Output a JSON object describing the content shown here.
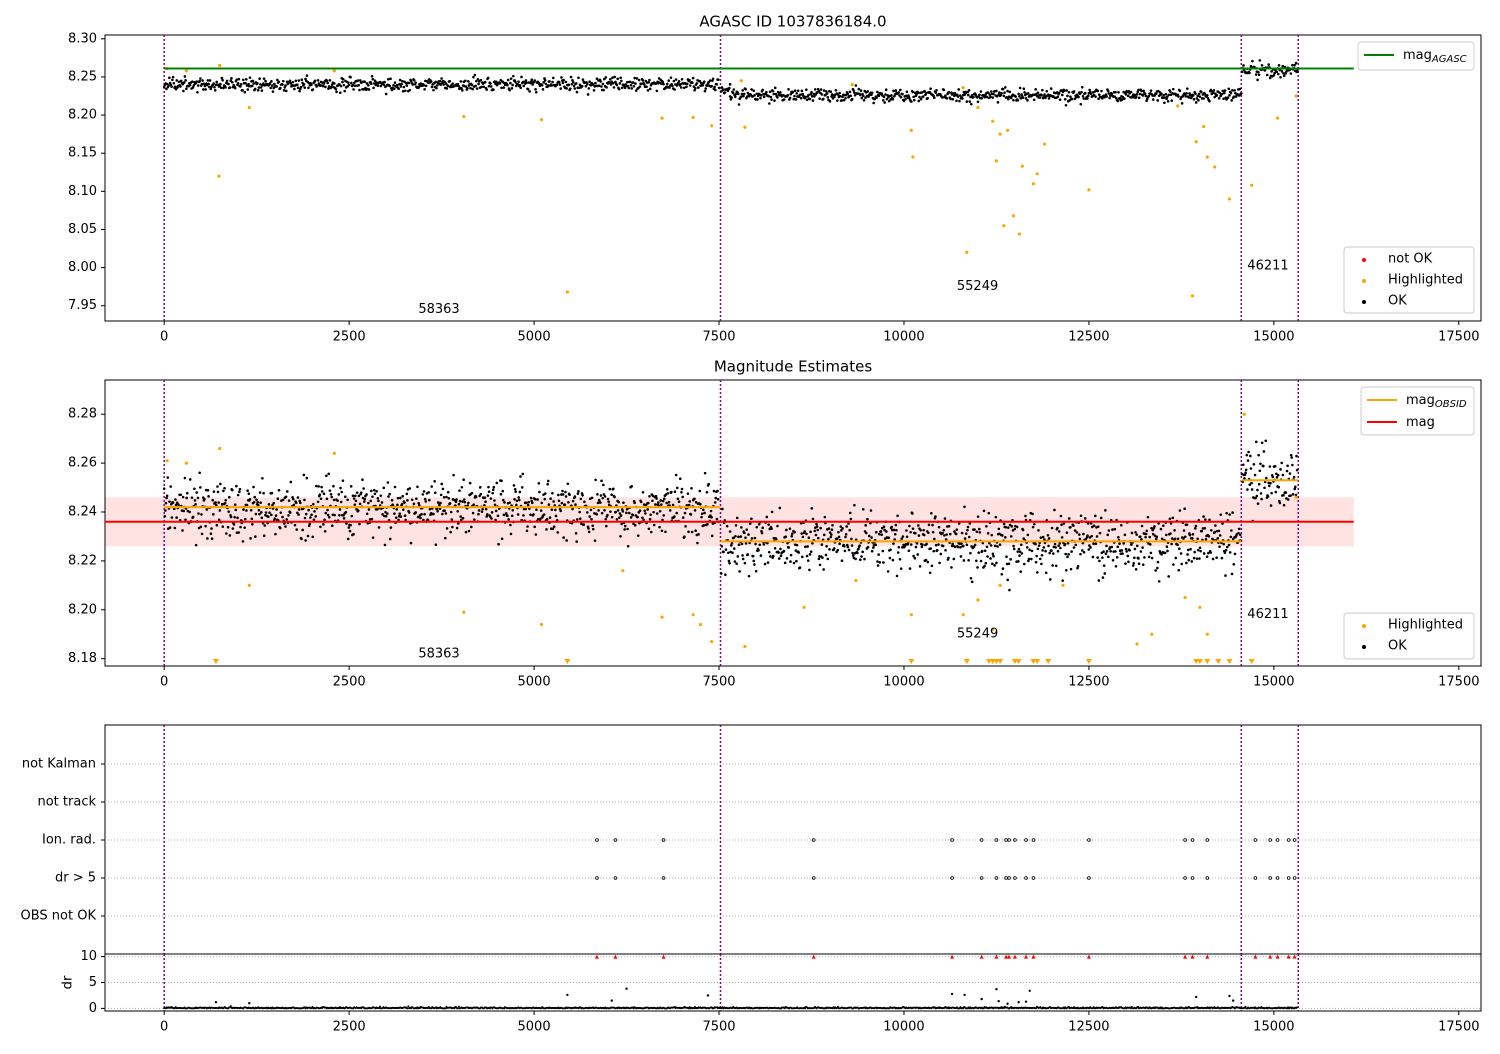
{
  "figure": {
    "x_ticks": [
      0,
      2500,
      5000,
      7500,
      10000,
      12500,
      15000,
      17500
    ],
    "obsids": [
      {
        "id": "58363",
        "start": 0,
        "end": 7520
      },
      {
        "id": "55249",
        "start": 7520,
        "end": 14560
      },
      {
        "id": "46211",
        "start": 14560,
        "end": 15330
      }
    ],
    "colors": {
      "ok": "#000000",
      "highlighted": "#ffa500",
      "not_ok": "#ff0000",
      "agasc": "#008000",
      "obsid_mag": "#ffa500",
      "mag": "#ff0000",
      "band": "#ffe0e0",
      "boundary": "#800080"
    }
  },
  "chart_data": [
    {
      "type": "scatter",
      "title": "AGASC ID 1037836184.0",
      "xlim": [
        -800,
        17800
      ],
      "ylim": [
        7.93,
        8.305
      ],
      "y_ticks": [
        7.95,
        8.0,
        8.05,
        8.1,
        8.15,
        8.2,
        8.25,
        8.3
      ],
      "y_tick_labels": [
        "7.95",
        "8.00",
        "8.05",
        "8.10",
        "8.15",
        "8.20",
        "8.25",
        "8.30"
      ],
      "lines": [
        {
          "name": "AGASC",
          "y": 8.261,
          "x": [
            0,
            16080
          ]
        }
      ],
      "legend": {
        "top_right": [
          {
            "prefix": "mag",
            "sub": "AGASC",
            "kind": "line",
            "color": "#008000"
          }
        ],
        "bottom_right": [
          {
            "label": "not OK",
            "kind": "dot",
            "color": "#ff0000"
          },
          {
            "label": "Highlighted",
            "kind": "dot",
            "color": "#ffa500"
          },
          {
            "label": "OK",
            "kind": "dot",
            "color": "#000000"
          }
        ]
      },
      "obsid_label_y": [
        7.945,
        7.975,
        8.002
      ],
      "highlighted": [
        [
          40,
          8.261
        ],
        [
          300,
          8.258
        ],
        [
          750,
          8.265
        ],
        [
          740,
          8.12
        ],
        [
          1150,
          8.21
        ],
        [
          2300,
          8.258
        ],
        [
          4050,
          8.198
        ],
        [
          5100,
          8.194
        ],
        [
          5450,
          7.968
        ],
        [
          6730,
          8.196
        ],
        [
          7150,
          8.197
        ],
        [
          7400,
          8.186
        ],
        [
          7800,
          8.245
        ],
        [
          7850,
          8.184
        ],
        [
          9300,
          8.24
        ],
        [
          10100,
          8.18
        ],
        [
          10120,
          8.145
        ],
        [
          10800,
          8.236
        ],
        [
          10850,
          8.02
        ],
        [
          11000,
          8.21
        ],
        [
          11200,
          8.192
        ],
        [
          11250,
          8.14
        ],
        [
          11300,
          8.175
        ],
        [
          11350,
          8.055
        ],
        [
          11400,
          8.18
        ],
        [
          11480,
          8.068
        ],
        [
          11560,
          8.044
        ],
        [
          11600,
          8.133
        ],
        [
          11750,
          8.11
        ],
        [
          11800,
          8.123
        ],
        [
          11900,
          8.162
        ],
        [
          12500,
          8.102
        ],
        [
          13700,
          8.212
        ],
        [
          13900,
          7.963
        ],
        [
          13950,
          8.165
        ],
        [
          14050,
          8.185
        ],
        [
          14100,
          8.145
        ],
        [
          14200,
          8.132
        ],
        [
          14400,
          8.09
        ],
        [
          14700,
          8.108
        ],
        [
          15050,
          8.196
        ],
        [
          15300,
          8.225
        ]
      ]
    },
    {
      "type": "scatter",
      "title": "Magnitude Estimates",
      "xlim": [
        -800,
        17800
      ],
      "ylim": [
        8.177,
        8.294
      ],
      "y_ticks": [
        8.18,
        8.2,
        8.22,
        8.24,
        8.26,
        8.28
      ],
      "y_tick_labels": [
        "8.18",
        "8.20",
        "8.22",
        "8.24",
        "8.26",
        "8.28"
      ],
      "mag": {
        "value": 8.236,
        "band": [
          8.226,
          8.246
        ],
        "x": [
          -800,
          16080
        ]
      },
      "obsid_mags": [
        {
          "x": [
            0,
            7520
          ],
          "y": 8.242
        },
        {
          "x": [
            7520,
            14560
          ],
          "y": 8.228
        },
        {
          "x": [
            14560,
            15330
          ],
          "y": 8.253
        }
      ],
      "legend": {
        "top_right": [
          {
            "prefix": "mag",
            "sub": "OBSID",
            "kind": "line",
            "color": "#ffa500"
          },
          {
            "prefix": "mag",
            "sub": "",
            "kind": "line",
            "color": "#ff0000"
          }
        ],
        "bottom_right": [
          {
            "label": "Highlighted",
            "kind": "dot",
            "color": "#ffa500"
          },
          {
            "label": "OK",
            "kind": "dot",
            "color": "#000000"
          }
        ]
      },
      "obsid_label_y": [
        8.182,
        8.19,
        8.198
      ],
      "highlighted": [
        [
          40,
          8.261
        ],
        [
          300,
          8.26
        ],
        [
          750,
          8.266
        ],
        [
          1150,
          8.21
        ],
        [
          2300,
          8.264
        ],
        [
          4050,
          8.199
        ],
        [
          5100,
          8.194
        ],
        [
          6200,
          8.216
        ],
        [
          6730,
          8.197
        ],
        [
          7150,
          8.198
        ],
        [
          7250,
          8.194
        ],
        [
          7400,
          8.187
        ],
        [
          7850,
          8.185
        ],
        [
          8650,
          8.201
        ],
        [
          9350,
          8.212
        ],
        [
          10100,
          8.198
        ],
        [
          10800,
          8.198
        ],
        [
          11000,
          8.204
        ],
        [
          11200,
          8.192
        ],
        [
          11300,
          8.21
        ],
        [
          12150,
          8.21
        ],
        [
          13150,
          8.186
        ],
        [
          13350,
          8.19
        ],
        [
          13800,
          8.205
        ],
        [
          14000,
          8.201
        ],
        [
          14100,
          8.19
        ],
        [
          14600,
          8.28
        ],
        [
          15300,
          8.246
        ]
      ],
      "off_scale": [
        700,
        5450,
        10100,
        10850,
        11150,
        11200,
        11250,
        11300,
        11500,
        11550,
        11750,
        11800,
        11950,
        12500,
        13950,
        14000,
        14100,
        14250,
        14400,
        14700
      ]
    },
    {
      "type": "scatter",
      "flag_rows": [
        "not Kalman",
        "not track",
        "Ion. rad.",
        "dr > 5",
        "OBS not OK"
      ],
      "flag_events": {
        "Ion. rad.": [
          5850,
          6100,
          6750,
          8780,
          10650,
          11050,
          11250,
          11380,
          11420,
          11500,
          11650,
          11750,
          12500,
          13800,
          13900,
          14100,
          14750,
          14950,
          15050,
          15200,
          15280
        ],
        "dr > 5": [
          5850,
          6100,
          6750,
          8780,
          10650,
          11050,
          11250,
          11380,
          11420,
          11500,
          11650,
          11750,
          12500,
          13800,
          13900,
          14100,
          14750,
          14950,
          15050,
          15200,
          15280
        ]
      },
      "dr": {
        "ylabel": "dr",
        "ylim": [
          -0.5,
          10.5
        ],
        "y_ticks": [
          0,
          5,
          10
        ],
        "y_tick_labels": [
          "0",
          "5",
          "10"
        ],
        "clipped_at_10": [
          5850,
          6100,
          6750,
          8780,
          10650,
          11050,
          11250,
          11380,
          11420,
          11500,
          11650,
          11750,
          12500,
          13800,
          13900,
          14100,
          14750,
          14950,
          15050,
          15200,
          15280
        ],
        "spikes": [
          [
            700,
            1.2
          ],
          [
            1150,
            1.0
          ],
          [
            5450,
            2.6
          ],
          [
            6050,
            1.5
          ],
          [
            6250,
            3.8
          ],
          [
            7350,
            2.5
          ],
          [
            10650,
            2.8
          ],
          [
            10820,
            2.6
          ],
          [
            11050,
            1.8
          ],
          [
            11250,
            3.7
          ],
          [
            11280,
            1.4
          ],
          [
            11400,
            0.9
          ],
          [
            11550,
            1.2
          ],
          [
            11650,
            1.3
          ],
          [
            11700,
            3.4
          ],
          [
            13950,
            2.2
          ],
          [
            14400,
            2.4
          ],
          [
            14450,
            1.5
          ]
        ]
      }
    }
  ]
}
